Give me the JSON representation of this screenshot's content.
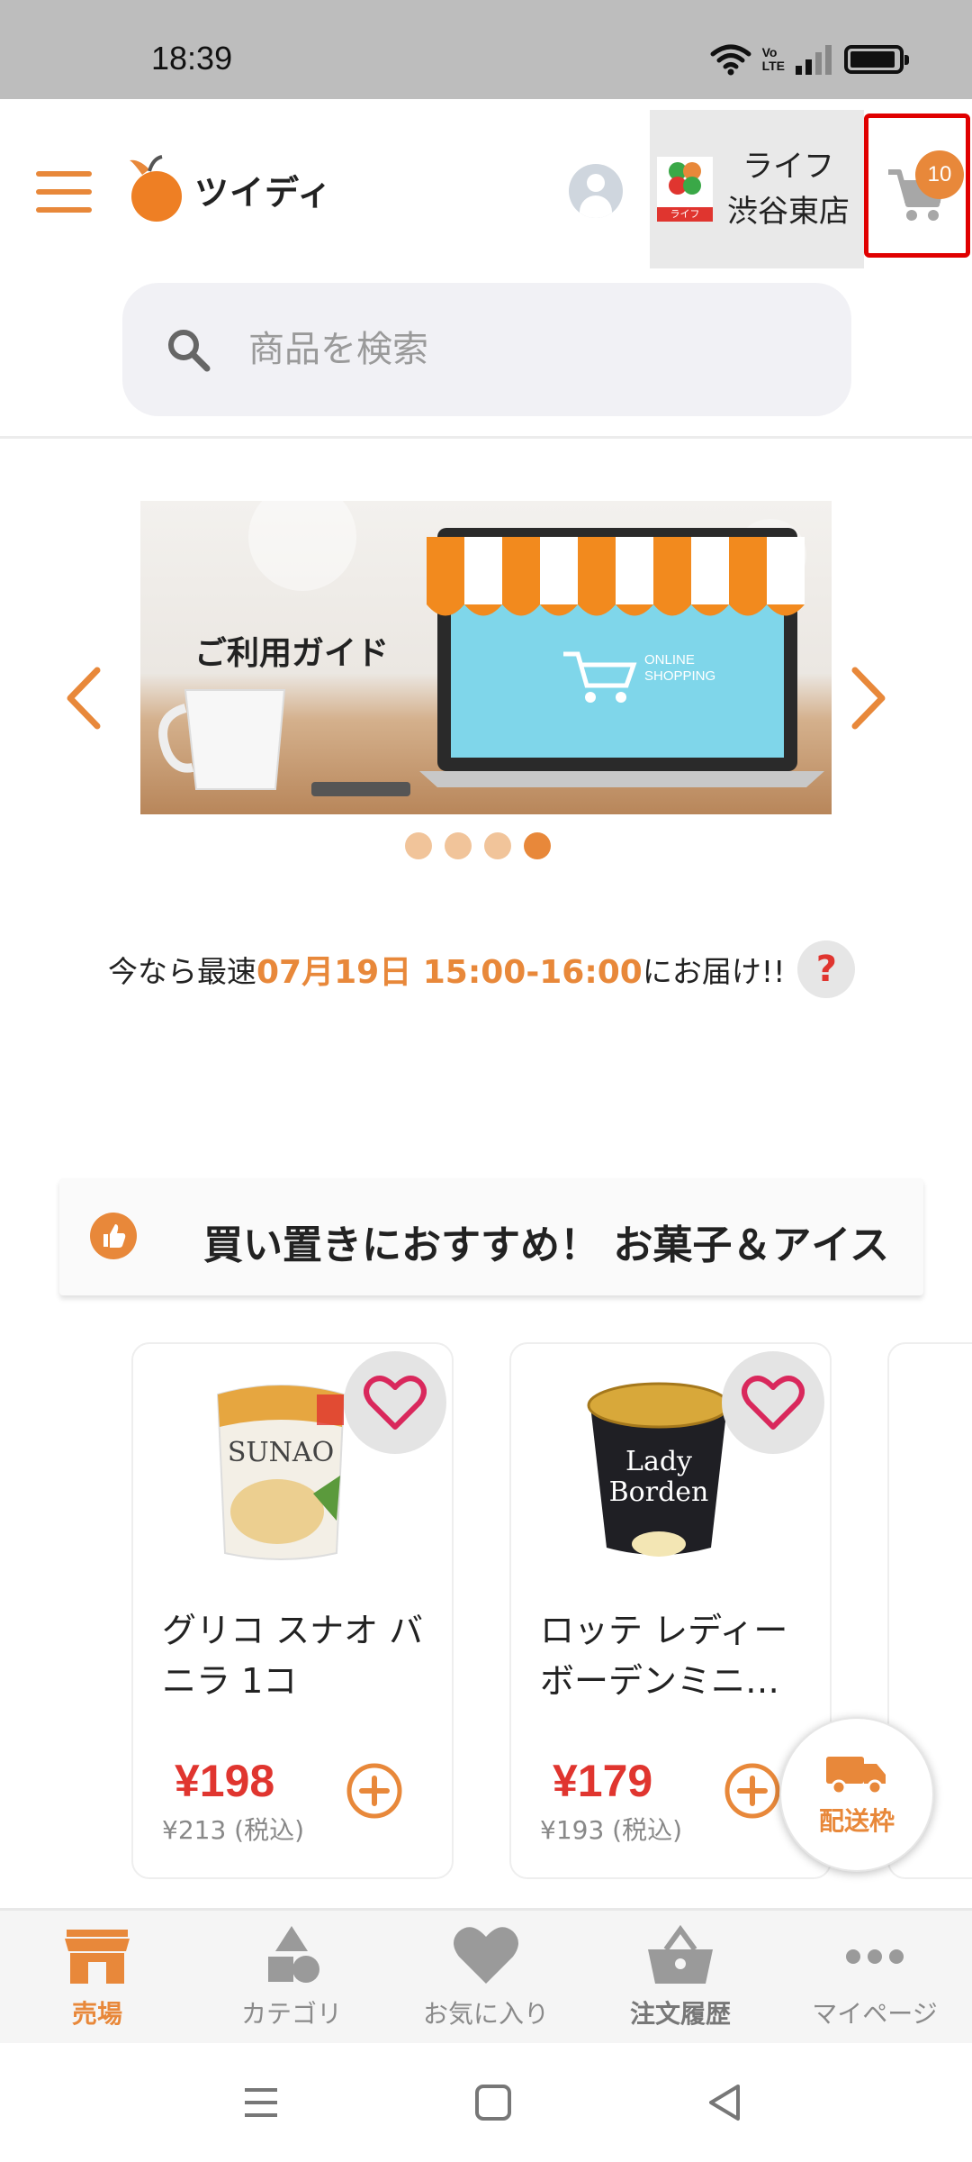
{
  "status_bar": {
    "time": "18:39",
    "network": "VoLTE"
  },
  "header": {
    "app_name": "ツイディ",
    "store": {
      "line1": "ライフ",
      "line2": "渋谷東店",
      "logo_text": "ライフ"
    },
    "cart_count": "10"
  },
  "search": {
    "placeholder": "商品を検索"
  },
  "banner": {
    "text": "ご利用ガイド",
    "screen_text": "ONLINE SHOPPING"
  },
  "delivery": {
    "prefix": "今なら最速",
    "highlight": "07月19日 15:00-16:00",
    "suffix": "にお届け!!",
    "help": "?"
  },
  "section": {
    "title": "買い置きにおすすめ！ お菓子＆アイス"
  },
  "products": [
    {
      "name": "グリコ スナオ バニラ 1コ",
      "price": "¥198",
      "tax_price": "¥213 (税込)"
    },
    {
      "name": "ロッテ レディーボーデンミニ…",
      "price": "¥179",
      "tax_price": "¥193 (税込)"
    }
  ],
  "delivery_fab": {
    "label": "配送枠"
  },
  "bottom_nav": [
    {
      "label": "売場",
      "icon": "store-icon"
    },
    {
      "label": "カテゴリ",
      "icon": "category-icon"
    },
    {
      "label": "お気に入り",
      "icon": "heart-icon"
    },
    {
      "label": "注文履歴",
      "icon": "basket-icon"
    },
    {
      "label": "マイページ",
      "icon": "more-icon"
    }
  ],
  "colors": {
    "accent": "#e8883a",
    "price": "#e0352f",
    "highlight_box": "#e00000"
  }
}
